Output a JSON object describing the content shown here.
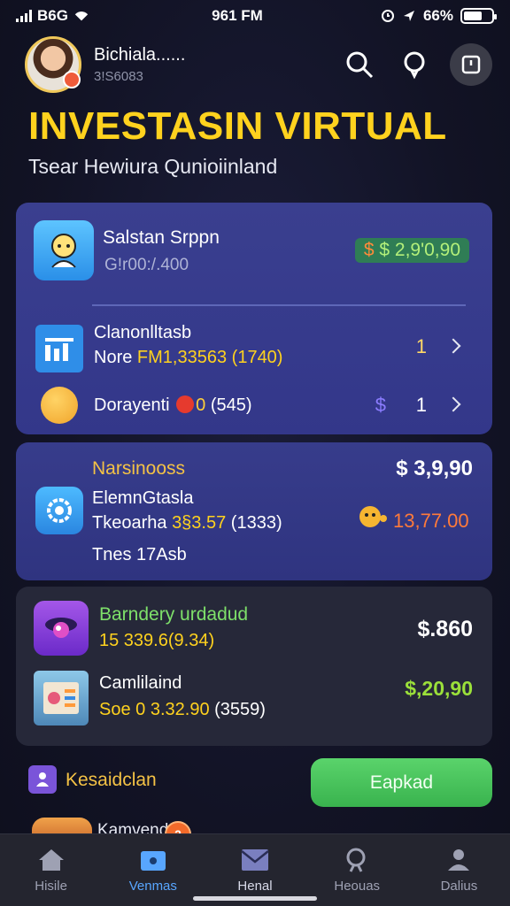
{
  "status_bar": {
    "carrier": "B6G",
    "time": "961 FM",
    "battery_percent": "66%",
    "battery_level": 0.66
  },
  "header": {
    "user_name": "Bichiala......",
    "user_id": "3!S6083"
  },
  "title": "INVESTASIN VIRTUAL",
  "subtitle": "Tsear Hewiura Qunioiinland",
  "card1": {
    "item1": {
      "name": "Salstan Srppn",
      "sub": "G!r00:/.400",
      "price": "$ 2,9'0,90"
    },
    "item2": {
      "name": "Clanonlltasb",
      "prefix": "Nore",
      "highlight": "FM1,33563",
      "suffix": "(1740)",
      "count": "1"
    },
    "item3": {
      "prefix": "Dorayenti",
      "mid": "0",
      "suffix": "(545)",
      "currency": "$",
      "count": "1"
    }
  },
  "card2": {
    "header": "Narsinooss",
    "total": "$ 3,9,90",
    "name": "ElemnGtasla",
    "detail_prefix": "Tkeoarha",
    "detail_value": "3§3.57",
    "detail_suffix": "(1333)",
    "footer": "Tnes 17Аsb",
    "value": "13,77.00"
  },
  "card3": {
    "item1": {
      "name": "Barndery urdadud",
      "detail": "15 339.6(9.34)",
      "price": "$.860"
    },
    "item2": {
      "name": "Camlilaind",
      "prefix": "Soe",
      "value": "0 3.32.90",
      "suffix": "(3559)",
      "price": "$,20,90"
    }
  },
  "recent": {
    "label": "Kesaidclan",
    "button": "Eapkad"
  },
  "peek": {
    "text": "Kamvend",
    "badge": "2"
  },
  "nav": {
    "items": [
      {
        "label": "Hisile"
      },
      {
        "label": "Venmas"
      },
      {
        "label": "Henal"
      },
      {
        "label": "Heouas"
      },
      {
        "label": "Dalius"
      }
    ]
  },
  "colors": {
    "accent_yellow": "#ffd21e",
    "green": "#39b34e",
    "card_blue": "#373c8b",
    "nav_active": "#58a6ff"
  }
}
